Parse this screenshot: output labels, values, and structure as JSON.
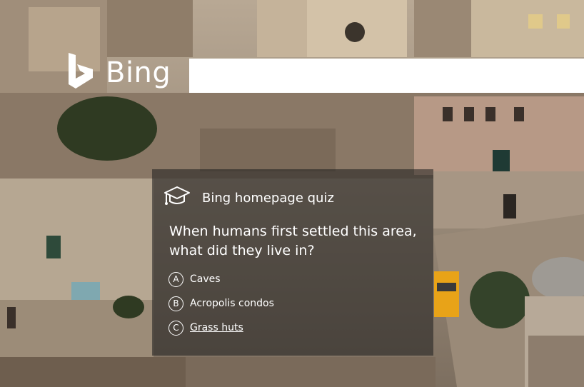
{
  "header": {
    "logo_text": "Bing",
    "logo_icon": "bing-b-icon"
  },
  "search": {
    "value": "",
    "placeholder": ""
  },
  "quiz": {
    "icon": "graduation-cap-icon",
    "title": "Bing homepage quiz",
    "question": "When humans first settled this area, what did they live in?",
    "options": [
      {
        "letter": "A",
        "label": "Caves"
      },
      {
        "letter": "B",
        "label": "Acropolis condos"
      },
      {
        "letter": "C",
        "label": "Grass huts"
      }
    ]
  },
  "colors": {
    "card_bg": "rgba(30,30,30,0.55)",
    "text": "#ffffff",
    "search_bg": "#ffffff"
  }
}
